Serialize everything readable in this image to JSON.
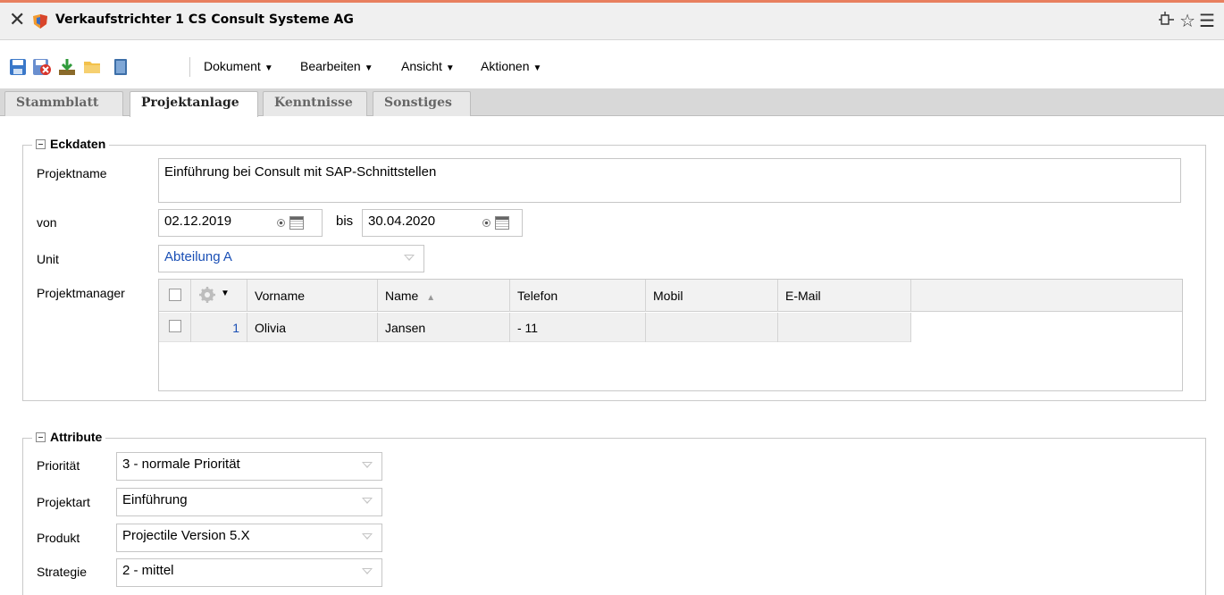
{
  "window": {
    "title": "Verkaufstrichter 1 CS Consult Systeme AG",
    "icons": [
      "close-icon",
      "logo-icon",
      "pin-icon",
      "star-icon",
      "hamburger-menu-icon"
    ]
  },
  "toolbar": {
    "icons": [
      "save-icon",
      "delete-icon",
      "download-icon",
      "folder-icon",
      "document-icon"
    ],
    "menus": {
      "dokument": "Dokument",
      "bearbeiten": "Bearbeiten",
      "ansicht": "Ansicht",
      "aktionen": "Aktionen"
    }
  },
  "tabs": {
    "stammblatt": "Stammblatt",
    "projektanlage": "Projektanlage",
    "kenntnisse": "Kenntnisse",
    "sonstiges": "Sonstiges",
    "active": "Projektanlage"
  },
  "eckdaten": {
    "legend": "Eckdaten",
    "projektname_label": "Projektname",
    "projektname_value": "Einführung bei Consult mit SAP-Schnittstellen",
    "von_label": "von",
    "von_value": "02.12.2019",
    "bis_label": "bis",
    "bis_value": "30.04.2020",
    "unit_label": "Unit",
    "unit_value": "Abteilung A",
    "projektmanager_label": "Projektmanager",
    "grid": {
      "columns": {
        "vorname": "Vorname",
        "name": "Name",
        "sort_indicator": "▲",
        "telefon": "Telefon",
        "mobil": "Mobil",
        "email": "E-Mail"
      },
      "rows": [
        {
          "nr": "1",
          "vorname": "Olivia",
          "name": "Jansen",
          "telefon": "- 11",
          "mobil": "",
          "email": ""
        }
      ]
    }
  },
  "attribute": {
    "legend": "Attribute",
    "prioritaet_label": "Priorität",
    "prioritaet_value": "3 - normale Priorität",
    "projektart_label": "Projektart",
    "projektart_value": "Einführung",
    "produkt_label": "Produkt",
    "produkt_value": "Projectile Version 5.X",
    "strategie_label": "Strategie",
    "strategie_value": "2 - mittel"
  },
  "colors": {
    "accent_line": "#e87f5f",
    "link_blue": "#1a4fb5",
    "tab_bar": "#d8d8d8"
  }
}
